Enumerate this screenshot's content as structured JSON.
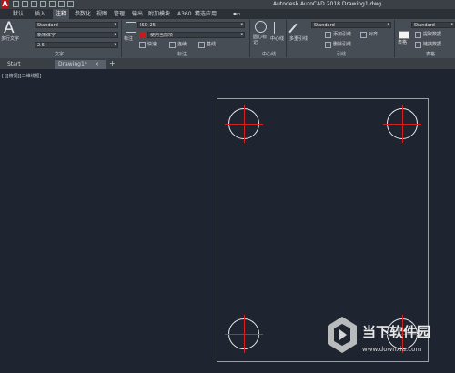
{
  "titlebar": {
    "title": "Autodesk AutoCAD 2018    Drawing1.dwg"
  },
  "menu": [
    "默认",
    "插入",
    "注释",
    "参数化",
    "视图",
    "管理",
    "输出",
    "附加模块",
    "A360",
    "精选应用",
    "▪▫"
  ],
  "menu_active_index": 2,
  "ribbon": {
    "text_panel": {
      "big_glyph": "A",
      "big_label": "多行文字",
      "style": "Standard",
      "font": "新宋体字",
      "height": "2.5",
      "title": "文字"
    },
    "dim_panel": {
      "big_label": "标注",
      "dimstyle": "ISO-25",
      "layer": "使用当前项",
      "quick": "快速",
      "continue": "连续",
      "baseline": "基线",
      "title": "标注"
    },
    "centerline_panel": {
      "center_mark": "圆心标记",
      "centerline": "中心线",
      "title": "中心线"
    },
    "leader_panel": {
      "multileader": "多重引线",
      "style": "Standard",
      "add": "添加引线",
      "remove": "删除引线",
      "align": "对齐",
      "title": "引线"
    },
    "table_panel": {
      "style": "Standard",
      "table": "表格",
      "extract": "提取数据",
      "link": "链接数据",
      "title": "表格"
    }
  },
  "tabs": [
    "Start",
    "Drawing1*"
  ],
  "tab_add": "+",
  "viewport_label": "[-][俯视][二维线框]",
  "watermark": {
    "name": "当下软件园",
    "url": "www.downxia.com"
  }
}
